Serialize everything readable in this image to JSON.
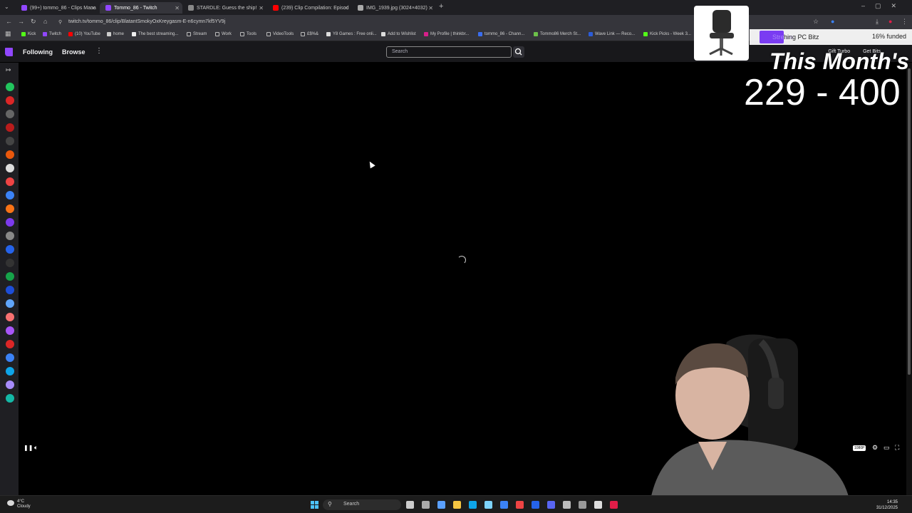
{
  "browser": {
    "tabs": [
      {
        "title": "(99+) tommo_86 - Clips Mana",
        "fav_color": "#9147ff"
      },
      {
        "title": "Tommo_86 - Twitch",
        "fav_color": "#9147ff"
      },
      {
        "title": "STARDLE: Guess the ship!",
        "fav_color": "#888888"
      },
      {
        "title": "(239) Clip Compilation: Episod",
        "fav_color": "#ff0000"
      },
      {
        "title": "IMG_1939.jpg (3024×4032)",
        "fav_color": "#aaaaaa"
      }
    ],
    "url": "twitch.tv/tommo_86/clip/BlatantSmokyOxKreygasm-E-n6cymn7kf5YV9j",
    "bookmarks": [
      {
        "label": "Kick",
        "color": "#53fc18"
      },
      {
        "label": "Twitch",
        "color": "#9147ff"
      },
      {
        "label": "(10) YouTube",
        "color": "#ff0000"
      },
      {
        "label": "home",
        "color": "#cccccc"
      },
      {
        "label": "The best streaming...",
        "color": "#eeeeee"
      },
      {
        "label": "Stream",
        "color": "#bbbbbb"
      },
      {
        "label": "Work",
        "color": "#bbbbbb"
      },
      {
        "label": "Tools",
        "color": "#bbbbbb"
      },
      {
        "label": "VideoTools",
        "color": "#bbbbbb"
      },
      {
        "label": "£$%&",
        "color": "#bbbbbb"
      },
      {
        "label": "Y8 Games : Free onli...",
        "color": "#dddddd"
      },
      {
        "label": "Add to Wishlist",
        "color": "#dddddd"
      },
      {
        "label": "My Profile | thinkbr...",
        "color": "#d61f8a"
      },
      {
        "label": "tommo_86 - Chann...",
        "color": "#3a6df0"
      },
      {
        "label": "Tommo86 Merch St...",
        "color": "#6cc04a"
      },
      {
        "label": "Wave Link — Reco...",
        "color": "#2b5cd9"
      },
      {
        "label": "Kick Picks - Week 3...",
        "color": "#53fc18"
      }
    ]
  },
  "twitch": {
    "nav": {
      "following": "Following",
      "browse": "Browse",
      "search_placeholder": "Search",
      "gift_turbo": "Gift Turbo",
      "get_bits": "Get Bits"
    },
    "rail_colors": [
      "#22c55e",
      "#dc2626",
      "#666666",
      "#b91c1c",
      "#444444",
      "#ea580c",
      "#dddddd",
      "#ef4444",
      "#3b82f6",
      "#f97316",
      "#7c3aed",
      "#888888",
      "#2563eb",
      "#333333",
      "#16a34a",
      "#1d4ed8",
      "#60a5fa",
      "#f87171",
      "#a855f7",
      "#dc2626",
      "#3b82f6",
      "#0ea5e9",
      "#a78bfa",
      "#14b8a6"
    ]
  },
  "player": {
    "quality": "1080P"
  },
  "overlay": {
    "goal_label": "hing PC Bitz",
    "goal_prefix": "Stream",
    "funded": "16% funded",
    "title": "This Month's",
    "count": "229 - 400"
  },
  "taskbar": {
    "weather_temp": "4°C",
    "weather_desc": "Cloudy",
    "search_label": "Search",
    "time": "14:35",
    "date": "31/12/2025",
    "app_colors": [
      "#cccccc",
      "#aaaaaa",
      "#5aa0ff",
      "#f5c542",
      "#0ea5e9",
      "#7dd3fc",
      "#3b82f6",
      "#ef4444",
      "#2563eb",
      "#5865f2",
      "#bbbbbb",
      "#999999",
      "#dddddd",
      "#e11d48"
    ]
  }
}
